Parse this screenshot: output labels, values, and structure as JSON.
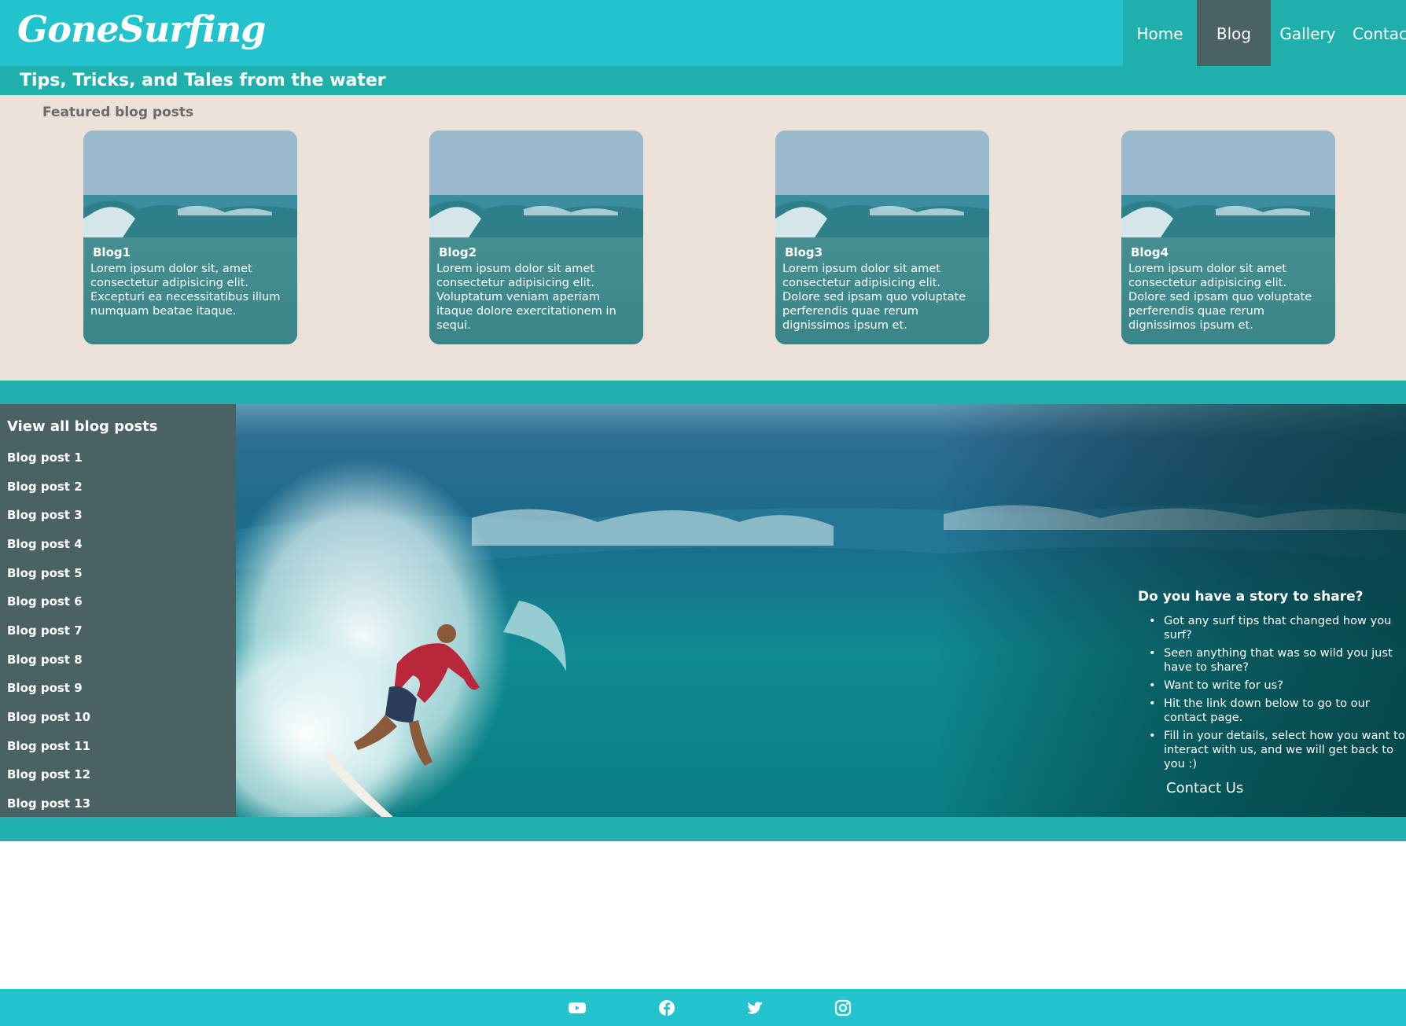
{
  "header": {
    "logo": "GoneSurfing",
    "tagline": "Tips, Tricks, and Tales from the water",
    "nav": [
      "Home",
      "Blog",
      "Gallery",
      "Contac"
    ],
    "active_nav": "Blog"
  },
  "featured": {
    "title": "Featured blog posts",
    "cards": [
      {
        "title": "Blog1",
        "text": "Lorem ipsum dolor sit, amet consectetur adipisicing elit. Excepturi ea necessitatibus illum numquam beatae itaque."
      },
      {
        "title": "Blog2",
        "text": "Lorem ipsum dolor sit amet consectetur adipisicing elit. Voluptatum veniam aperiam itaque dolore exercitationem in sequi."
      },
      {
        "title": "Blog3",
        "text": "Lorem ipsum dolor sit amet consectetur adipisicing elit. Dolore sed ipsam quo voluptate perferendis quae rerum dignissimos ipsum et."
      },
      {
        "title": "Blog4",
        "text": "Lorem ipsum dolor sit amet consectetur adipisicing elit. Dolore sed ipsam quo voluptate perferendis quae rerum dignissimos ipsum et."
      }
    ]
  },
  "sidebar": {
    "title": "View all blog posts",
    "posts": [
      "Blog post 1",
      "Blog post 2",
      "Blog post 3",
      "Blog post 4",
      "Blog post 5",
      "Blog post 6",
      "Blog post 7",
      "Blog post 8",
      "Blog post 9",
      "Blog post 10",
      "Blog post 11",
      "Blog post 12",
      "Blog post 13"
    ]
  },
  "story": {
    "title": "Do you have a story to share?",
    "bullets": [
      "Got any surf tips that changed how you surf?",
      "Seen anything that was so wild you just have to share?",
      "Want to write for us?",
      "Hit the link down below to go to our contact page.",
      "Fill in your details, select how you want to interact with us, and we will get back to you :)"
    ],
    "link": "Contact Us"
  },
  "footer": {
    "icons": [
      "youtube-icon",
      "facebook-icon",
      "twitter-icon",
      "instagram-icon"
    ]
  },
  "colors": {
    "header": "#22c3cc",
    "teal_band": "#1fb0ab",
    "slate": "#4a6264",
    "sand": "#ece1d8"
  }
}
